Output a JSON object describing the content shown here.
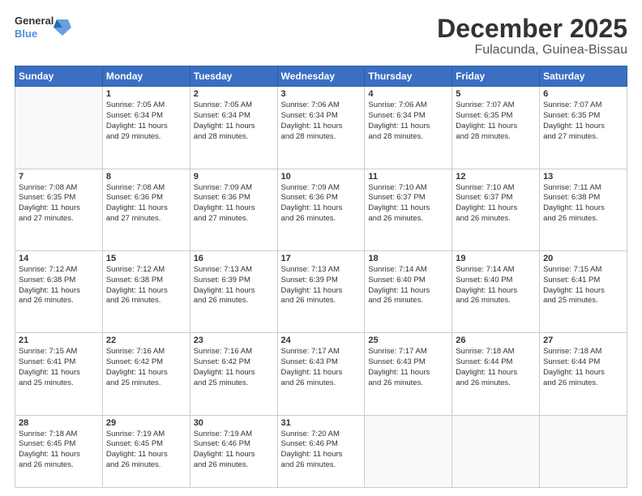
{
  "logo": {
    "line1": "General",
    "line2": "Blue"
  },
  "title": "December 2025",
  "subtitle": "Fulacunda, Guinea-Bissau",
  "weekdays": [
    "Sunday",
    "Monday",
    "Tuesday",
    "Wednesday",
    "Thursday",
    "Friday",
    "Saturday"
  ],
  "weeks": [
    [
      {
        "day": "",
        "content": ""
      },
      {
        "day": "1",
        "content": "Sunrise: 7:05 AM\nSunset: 6:34 PM\nDaylight: 11 hours\nand 29 minutes."
      },
      {
        "day": "2",
        "content": "Sunrise: 7:05 AM\nSunset: 6:34 PM\nDaylight: 11 hours\nand 28 minutes."
      },
      {
        "day": "3",
        "content": "Sunrise: 7:06 AM\nSunset: 6:34 PM\nDaylight: 11 hours\nand 28 minutes."
      },
      {
        "day": "4",
        "content": "Sunrise: 7:06 AM\nSunset: 6:34 PM\nDaylight: 11 hours\nand 28 minutes."
      },
      {
        "day": "5",
        "content": "Sunrise: 7:07 AM\nSunset: 6:35 PM\nDaylight: 11 hours\nand 28 minutes."
      },
      {
        "day": "6",
        "content": "Sunrise: 7:07 AM\nSunset: 6:35 PM\nDaylight: 11 hours\nand 27 minutes."
      }
    ],
    [
      {
        "day": "7",
        "content": "Sunrise: 7:08 AM\nSunset: 6:35 PM\nDaylight: 11 hours\nand 27 minutes."
      },
      {
        "day": "8",
        "content": "Sunrise: 7:08 AM\nSunset: 6:36 PM\nDaylight: 11 hours\nand 27 minutes."
      },
      {
        "day": "9",
        "content": "Sunrise: 7:09 AM\nSunset: 6:36 PM\nDaylight: 11 hours\nand 27 minutes."
      },
      {
        "day": "10",
        "content": "Sunrise: 7:09 AM\nSunset: 6:36 PM\nDaylight: 11 hours\nand 26 minutes."
      },
      {
        "day": "11",
        "content": "Sunrise: 7:10 AM\nSunset: 6:37 PM\nDaylight: 11 hours\nand 26 minutes."
      },
      {
        "day": "12",
        "content": "Sunrise: 7:10 AM\nSunset: 6:37 PM\nDaylight: 11 hours\nand 26 minutes."
      },
      {
        "day": "13",
        "content": "Sunrise: 7:11 AM\nSunset: 6:38 PM\nDaylight: 11 hours\nand 26 minutes."
      }
    ],
    [
      {
        "day": "14",
        "content": "Sunrise: 7:12 AM\nSunset: 6:38 PM\nDaylight: 11 hours\nand 26 minutes."
      },
      {
        "day": "15",
        "content": "Sunrise: 7:12 AM\nSunset: 6:38 PM\nDaylight: 11 hours\nand 26 minutes."
      },
      {
        "day": "16",
        "content": "Sunrise: 7:13 AM\nSunset: 6:39 PM\nDaylight: 11 hours\nand 26 minutes."
      },
      {
        "day": "17",
        "content": "Sunrise: 7:13 AM\nSunset: 6:39 PM\nDaylight: 11 hours\nand 26 minutes."
      },
      {
        "day": "18",
        "content": "Sunrise: 7:14 AM\nSunset: 6:40 PM\nDaylight: 11 hours\nand 26 minutes."
      },
      {
        "day": "19",
        "content": "Sunrise: 7:14 AM\nSunset: 6:40 PM\nDaylight: 11 hours\nand 26 minutes."
      },
      {
        "day": "20",
        "content": "Sunrise: 7:15 AM\nSunset: 6:41 PM\nDaylight: 11 hours\nand 25 minutes."
      }
    ],
    [
      {
        "day": "21",
        "content": "Sunrise: 7:15 AM\nSunset: 6:41 PM\nDaylight: 11 hours\nand 25 minutes."
      },
      {
        "day": "22",
        "content": "Sunrise: 7:16 AM\nSunset: 6:42 PM\nDaylight: 11 hours\nand 25 minutes."
      },
      {
        "day": "23",
        "content": "Sunrise: 7:16 AM\nSunset: 6:42 PM\nDaylight: 11 hours\nand 25 minutes."
      },
      {
        "day": "24",
        "content": "Sunrise: 7:17 AM\nSunset: 6:43 PM\nDaylight: 11 hours\nand 26 minutes."
      },
      {
        "day": "25",
        "content": "Sunrise: 7:17 AM\nSunset: 6:43 PM\nDaylight: 11 hours\nand 26 minutes."
      },
      {
        "day": "26",
        "content": "Sunrise: 7:18 AM\nSunset: 6:44 PM\nDaylight: 11 hours\nand 26 minutes."
      },
      {
        "day": "27",
        "content": "Sunrise: 7:18 AM\nSunset: 6:44 PM\nDaylight: 11 hours\nand 26 minutes."
      }
    ],
    [
      {
        "day": "28",
        "content": "Sunrise: 7:18 AM\nSunset: 6:45 PM\nDaylight: 11 hours\nand 26 minutes."
      },
      {
        "day": "29",
        "content": "Sunrise: 7:19 AM\nSunset: 6:45 PM\nDaylight: 11 hours\nand 26 minutes."
      },
      {
        "day": "30",
        "content": "Sunrise: 7:19 AM\nSunset: 6:46 PM\nDaylight: 11 hours\nand 26 minutes."
      },
      {
        "day": "31",
        "content": "Sunrise: 7:20 AM\nSunset: 6:46 PM\nDaylight: 11 hours\nand 26 minutes."
      },
      {
        "day": "",
        "content": ""
      },
      {
        "day": "",
        "content": ""
      },
      {
        "day": "",
        "content": ""
      }
    ]
  ]
}
